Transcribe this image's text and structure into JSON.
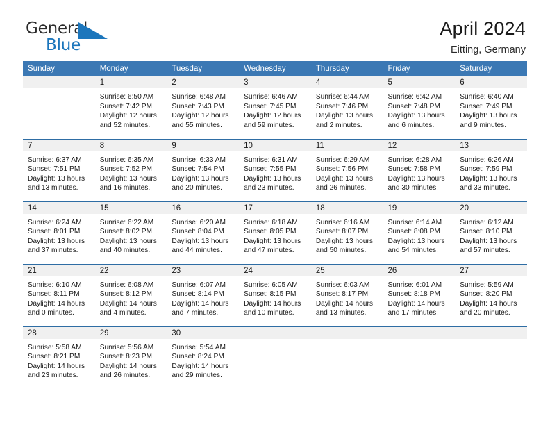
{
  "brand": {
    "name_line1": "General",
    "name_line2": "Blue",
    "accent_color": "#1c76bc"
  },
  "header": {
    "title": "April 2024",
    "subtitle": "Eitting, Germany"
  },
  "theme": {
    "header_row_bg": "#3b78b4",
    "daynum_band_bg": "#f0f0f0",
    "row_divider": "#2e6da4",
    "text": "#1a1a1a"
  },
  "calendar": {
    "weekday_headers": [
      "Sunday",
      "Monday",
      "Tuesday",
      "Wednesday",
      "Thursday",
      "Friday",
      "Saturday"
    ],
    "weeks": [
      [
        {
          "empty": true
        },
        {
          "day": "1",
          "sunrise": "Sunrise: 6:50 AM",
          "sunset": "Sunset: 7:42 PM",
          "daylight_line1": "Daylight: 12 hours",
          "daylight_line2": "and 52 minutes."
        },
        {
          "day": "2",
          "sunrise": "Sunrise: 6:48 AM",
          "sunset": "Sunset: 7:43 PM",
          "daylight_line1": "Daylight: 12 hours",
          "daylight_line2": "and 55 minutes."
        },
        {
          "day": "3",
          "sunrise": "Sunrise: 6:46 AM",
          "sunset": "Sunset: 7:45 PM",
          "daylight_line1": "Daylight: 12 hours",
          "daylight_line2": "and 59 minutes."
        },
        {
          "day": "4",
          "sunrise": "Sunrise: 6:44 AM",
          "sunset": "Sunset: 7:46 PM",
          "daylight_line1": "Daylight: 13 hours",
          "daylight_line2": "and 2 minutes."
        },
        {
          "day": "5",
          "sunrise": "Sunrise: 6:42 AM",
          "sunset": "Sunset: 7:48 PM",
          "daylight_line1": "Daylight: 13 hours",
          "daylight_line2": "and 6 minutes."
        },
        {
          "day": "6",
          "sunrise": "Sunrise: 6:40 AM",
          "sunset": "Sunset: 7:49 PM",
          "daylight_line1": "Daylight: 13 hours",
          "daylight_line2": "and 9 minutes."
        }
      ],
      [
        {
          "day": "7",
          "sunrise": "Sunrise: 6:37 AM",
          "sunset": "Sunset: 7:51 PM",
          "daylight_line1": "Daylight: 13 hours",
          "daylight_line2": "and 13 minutes."
        },
        {
          "day": "8",
          "sunrise": "Sunrise: 6:35 AM",
          "sunset": "Sunset: 7:52 PM",
          "daylight_line1": "Daylight: 13 hours",
          "daylight_line2": "and 16 minutes."
        },
        {
          "day": "9",
          "sunrise": "Sunrise: 6:33 AM",
          "sunset": "Sunset: 7:54 PM",
          "daylight_line1": "Daylight: 13 hours",
          "daylight_line2": "and 20 minutes."
        },
        {
          "day": "10",
          "sunrise": "Sunrise: 6:31 AM",
          "sunset": "Sunset: 7:55 PM",
          "daylight_line1": "Daylight: 13 hours",
          "daylight_line2": "and 23 minutes."
        },
        {
          "day": "11",
          "sunrise": "Sunrise: 6:29 AM",
          "sunset": "Sunset: 7:56 PM",
          "daylight_line1": "Daylight: 13 hours",
          "daylight_line2": "and 26 minutes."
        },
        {
          "day": "12",
          "sunrise": "Sunrise: 6:28 AM",
          "sunset": "Sunset: 7:58 PM",
          "daylight_line1": "Daylight: 13 hours",
          "daylight_line2": "and 30 minutes."
        },
        {
          "day": "13",
          "sunrise": "Sunrise: 6:26 AM",
          "sunset": "Sunset: 7:59 PM",
          "daylight_line1": "Daylight: 13 hours",
          "daylight_line2": "and 33 minutes."
        }
      ],
      [
        {
          "day": "14",
          "sunrise": "Sunrise: 6:24 AM",
          "sunset": "Sunset: 8:01 PM",
          "daylight_line1": "Daylight: 13 hours",
          "daylight_line2": "and 37 minutes."
        },
        {
          "day": "15",
          "sunrise": "Sunrise: 6:22 AM",
          "sunset": "Sunset: 8:02 PM",
          "daylight_line1": "Daylight: 13 hours",
          "daylight_line2": "and 40 minutes."
        },
        {
          "day": "16",
          "sunrise": "Sunrise: 6:20 AM",
          "sunset": "Sunset: 8:04 PM",
          "daylight_line1": "Daylight: 13 hours",
          "daylight_line2": "and 44 minutes."
        },
        {
          "day": "17",
          "sunrise": "Sunrise: 6:18 AM",
          "sunset": "Sunset: 8:05 PM",
          "daylight_line1": "Daylight: 13 hours",
          "daylight_line2": "and 47 minutes."
        },
        {
          "day": "18",
          "sunrise": "Sunrise: 6:16 AM",
          "sunset": "Sunset: 8:07 PM",
          "daylight_line1": "Daylight: 13 hours",
          "daylight_line2": "and 50 minutes."
        },
        {
          "day": "19",
          "sunrise": "Sunrise: 6:14 AM",
          "sunset": "Sunset: 8:08 PM",
          "daylight_line1": "Daylight: 13 hours",
          "daylight_line2": "and 54 minutes."
        },
        {
          "day": "20",
          "sunrise": "Sunrise: 6:12 AM",
          "sunset": "Sunset: 8:10 PM",
          "daylight_line1": "Daylight: 13 hours",
          "daylight_line2": "and 57 minutes."
        }
      ],
      [
        {
          "day": "21",
          "sunrise": "Sunrise: 6:10 AM",
          "sunset": "Sunset: 8:11 PM",
          "daylight_line1": "Daylight: 14 hours",
          "daylight_line2": "and 0 minutes."
        },
        {
          "day": "22",
          "sunrise": "Sunrise: 6:08 AM",
          "sunset": "Sunset: 8:12 PM",
          "daylight_line1": "Daylight: 14 hours",
          "daylight_line2": "and 4 minutes."
        },
        {
          "day": "23",
          "sunrise": "Sunrise: 6:07 AM",
          "sunset": "Sunset: 8:14 PM",
          "daylight_line1": "Daylight: 14 hours",
          "daylight_line2": "and 7 minutes."
        },
        {
          "day": "24",
          "sunrise": "Sunrise: 6:05 AM",
          "sunset": "Sunset: 8:15 PM",
          "daylight_line1": "Daylight: 14 hours",
          "daylight_line2": "and 10 minutes."
        },
        {
          "day": "25",
          "sunrise": "Sunrise: 6:03 AM",
          "sunset": "Sunset: 8:17 PM",
          "daylight_line1": "Daylight: 14 hours",
          "daylight_line2": "and 13 minutes."
        },
        {
          "day": "26",
          "sunrise": "Sunrise: 6:01 AM",
          "sunset": "Sunset: 8:18 PM",
          "daylight_line1": "Daylight: 14 hours",
          "daylight_line2": "and 17 minutes."
        },
        {
          "day": "27",
          "sunrise": "Sunrise: 5:59 AM",
          "sunset": "Sunset: 8:20 PM",
          "daylight_line1": "Daylight: 14 hours",
          "daylight_line2": "and 20 minutes."
        }
      ],
      [
        {
          "day": "28",
          "sunrise": "Sunrise: 5:58 AM",
          "sunset": "Sunset: 8:21 PM",
          "daylight_line1": "Daylight: 14 hours",
          "daylight_line2": "and 23 minutes."
        },
        {
          "day": "29",
          "sunrise": "Sunrise: 5:56 AM",
          "sunset": "Sunset: 8:23 PM",
          "daylight_line1": "Daylight: 14 hours",
          "daylight_line2": "and 26 minutes."
        },
        {
          "day": "30",
          "sunrise": "Sunrise: 5:54 AM",
          "sunset": "Sunset: 8:24 PM",
          "daylight_line1": "Daylight: 14 hours",
          "daylight_line2": "and 29 minutes."
        },
        {
          "empty": true
        },
        {
          "empty": true
        },
        {
          "empty": true
        },
        {
          "empty": true
        }
      ]
    ]
  }
}
